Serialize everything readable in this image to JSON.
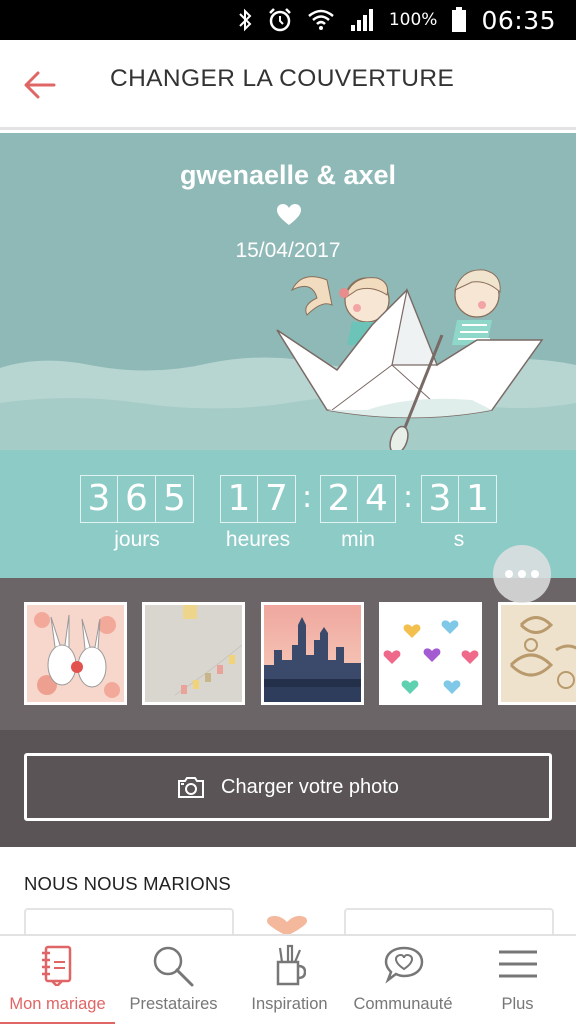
{
  "status_bar": {
    "battery_percent": "100%",
    "time": "06:35",
    "icons": [
      "bluetooth-icon",
      "alarm-icon",
      "wifi-icon",
      "signal-icon",
      "battery-icon"
    ]
  },
  "header": {
    "title": "CHANGER LA COUVERTURE",
    "back_icon": "arrow-left-icon"
  },
  "cover": {
    "names": "gwenaelle & axel",
    "date": "15/04/2017",
    "countdown": {
      "days": [
        "3",
        "6",
        "5"
      ],
      "hours": [
        "1",
        "7"
      ],
      "minutes": [
        "2",
        "4"
      ],
      "seconds": [
        "3",
        "1"
      ],
      "separator": ":",
      "labels": {
        "days": "jours",
        "hours": "heures",
        "minutes": "min",
        "seconds": "s"
      }
    }
  },
  "thumbnails": [
    {
      "name": "bunnies-theme"
    },
    {
      "name": "garland-theme"
    },
    {
      "name": "city-skyline-theme"
    },
    {
      "name": "hearts-theme"
    },
    {
      "name": "damask-theme"
    }
  ],
  "upload": {
    "label": "Charger votre photo",
    "icon": "camera-icon"
  },
  "section": {
    "title": "NOUS NOUS MARIONS"
  },
  "bottom_nav": {
    "active_index": 0,
    "items": [
      {
        "label": "Mon mariage",
        "icon": "notebook-icon"
      },
      {
        "label": "Prestataires",
        "icon": "search-icon"
      },
      {
        "label": "Inspiration",
        "icon": "pencil-cup-icon"
      },
      {
        "label": "Communauté",
        "icon": "chat-heart-icon"
      },
      {
        "label": "Plus",
        "icon": "menu-icon"
      }
    ]
  },
  "colors": {
    "accent": "#e06565",
    "cover_sky": "#8fb9b6",
    "countdown_bg": "#8ccbc6",
    "thumb_strip_bg": "#6b6567",
    "upload_bg": "#5a5456"
  }
}
